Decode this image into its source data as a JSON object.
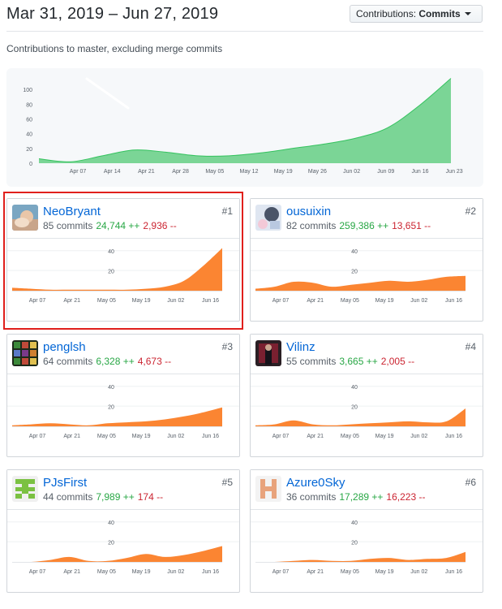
{
  "header": {
    "date_range": "Mar 31, 2019 – Jun 27, 2019",
    "select_label": "Contributions:",
    "select_value": "Commits",
    "subtitle": "Contributions to master, excluding merge commits"
  },
  "colors": {
    "main_area": "#7bd596",
    "main_line": "#34c25e",
    "user_area": "#fb8532",
    "link": "#0366d6",
    "additions": "#28a745",
    "deletions": "#cb2431",
    "highlight": "#e0201c"
  },
  "chart_data": [
    {
      "type": "area",
      "title": "Contributions to master, excluding merge commits",
      "x_ticks": [
        "Apr 07",
        "Apr 14",
        "Apr 21",
        "Apr 28",
        "May 05",
        "May 12",
        "May 19",
        "May 26",
        "Jun 02",
        "Jun 09",
        "Jun 16",
        "Jun 23"
      ],
      "y_ticks": [
        "0",
        "20",
        "40",
        "60",
        "80",
        "100"
      ],
      "ylim": [
        0,
        120
      ],
      "x": [
        0,
        1,
        2,
        3,
        4,
        5,
        6,
        7,
        8,
        9,
        10,
        11,
        12,
        13
      ],
      "values": [
        6,
        2,
        10,
        18,
        15,
        10,
        10,
        14,
        20,
        26,
        34,
        48,
        78,
        115
      ],
      "series": [
        {
          "values": [
            6,
            2,
            10,
            18,
            15,
            10,
            10,
            14,
            20,
            26,
            34,
            48,
            78,
            115
          ]
        }
      ]
    }
  ],
  "contributors": [
    {
      "login": "NeoBryant",
      "commits": "85 commits",
      "additions": "24,744 ++",
      "deletions": "2,936 --",
      "rank": "#1",
      "chart_data": {
        "type": "area",
        "x_ticks": [
          "Apr 07",
          "Apr 21",
          "May 05",
          "May 19",
          "Jun 02",
          "Jun 16"
        ],
        "y_ticks": [
          "20",
          "40"
        ],
        "ylim": [
          0,
          50
        ],
        "values": [
          3,
          2,
          1,
          1,
          1,
          1,
          1,
          2,
          4,
          10,
          25,
          43
        ]
      }
    },
    {
      "login": "ousuixin",
      "commits": "82 commits",
      "additions": "259,386 ++",
      "deletions": "13,651 --",
      "rank": "#2",
      "chart_data": {
        "type": "area",
        "x_ticks": [
          "Apr 07",
          "Apr 21",
          "May 05",
          "May 19",
          "Jun 02",
          "Jun 16"
        ],
        "y_ticks": [
          "20",
          "40"
        ],
        "ylim": [
          0,
          50
        ],
        "values": [
          2,
          4,
          9,
          8,
          4,
          6,
          8,
          10,
          9,
          11,
          14,
          15
        ]
      }
    },
    {
      "login": "penglsh",
      "commits": "64 commits",
      "additions": "6,328 ++",
      "deletions": "4,673 --",
      "rank": "#3",
      "chart_data": {
        "type": "area",
        "x_ticks": [
          "Apr 07",
          "Apr 21",
          "May 05",
          "May 19",
          "Jun 02",
          "Jun 16"
        ],
        "y_ticks": [
          "20",
          "40"
        ],
        "ylim": [
          0,
          50
        ],
        "values": [
          1,
          2,
          3,
          2,
          1,
          3,
          4,
          5,
          7,
          10,
          14,
          19
        ]
      }
    },
    {
      "login": "Vilinz",
      "commits": "55 commits",
      "additions": "3,665 ++",
      "deletions": "2,005 --",
      "rank": "#4",
      "chart_data": {
        "type": "area",
        "x_ticks": [
          "Apr 07",
          "Apr 21",
          "May 05",
          "May 19",
          "Jun 02",
          "Jun 16"
        ],
        "y_ticks": [
          "20",
          "40"
        ],
        "ylim": [
          0,
          50
        ],
        "values": [
          1,
          2,
          6,
          2,
          1,
          2,
          3,
          4,
          5,
          4,
          5,
          18
        ]
      }
    },
    {
      "login": "PJsFirst",
      "commits": "44 commits",
      "additions": "7,989 ++",
      "deletions": "174 --",
      "rank": "#5",
      "chart_data": {
        "type": "area",
        "x_ticks": [
          "Apr 07",
          "Apr 21",
          "May 05",
          "May 19",
          "Jun 02",
          "Jun 16"
        ],
        "y_ticks": [
          "20",
          "40"
        ],
        "ylim": [
          0,
          50
        ],
        "values": [
          0,
          0,
          2,
          5,
          1,
          1,
          4,
          8,
          5,
          7,
          11,
          16
        ]
      }
    },
    {
      "login": "Azure0Sky",
      "commits": "36 commits",
      "additions": "17,289 ++",
      "deletions": "16,223 --",
      "rank": "#6",
      "chart_data": {
        "type": "area",
        "x_ticks": [
          "Apr 07",
          "Apr 21",
          "May 05",
          "May 19",
          "Jun 02",
          "Jun 16"
        ],
        "y_ticks": [
          "20",
          "40"
        ],
        "ylim": [
          0,
          50
        ],
        "values": [
          0,
          0,
          1,
          2,
          1,
          1,
          3,
          4,
          2,
          3,
          4,
          10
        ]
      }
    }
  ],
  "icons": {
    "dropdown": "caret-down-icon"
  }
}
